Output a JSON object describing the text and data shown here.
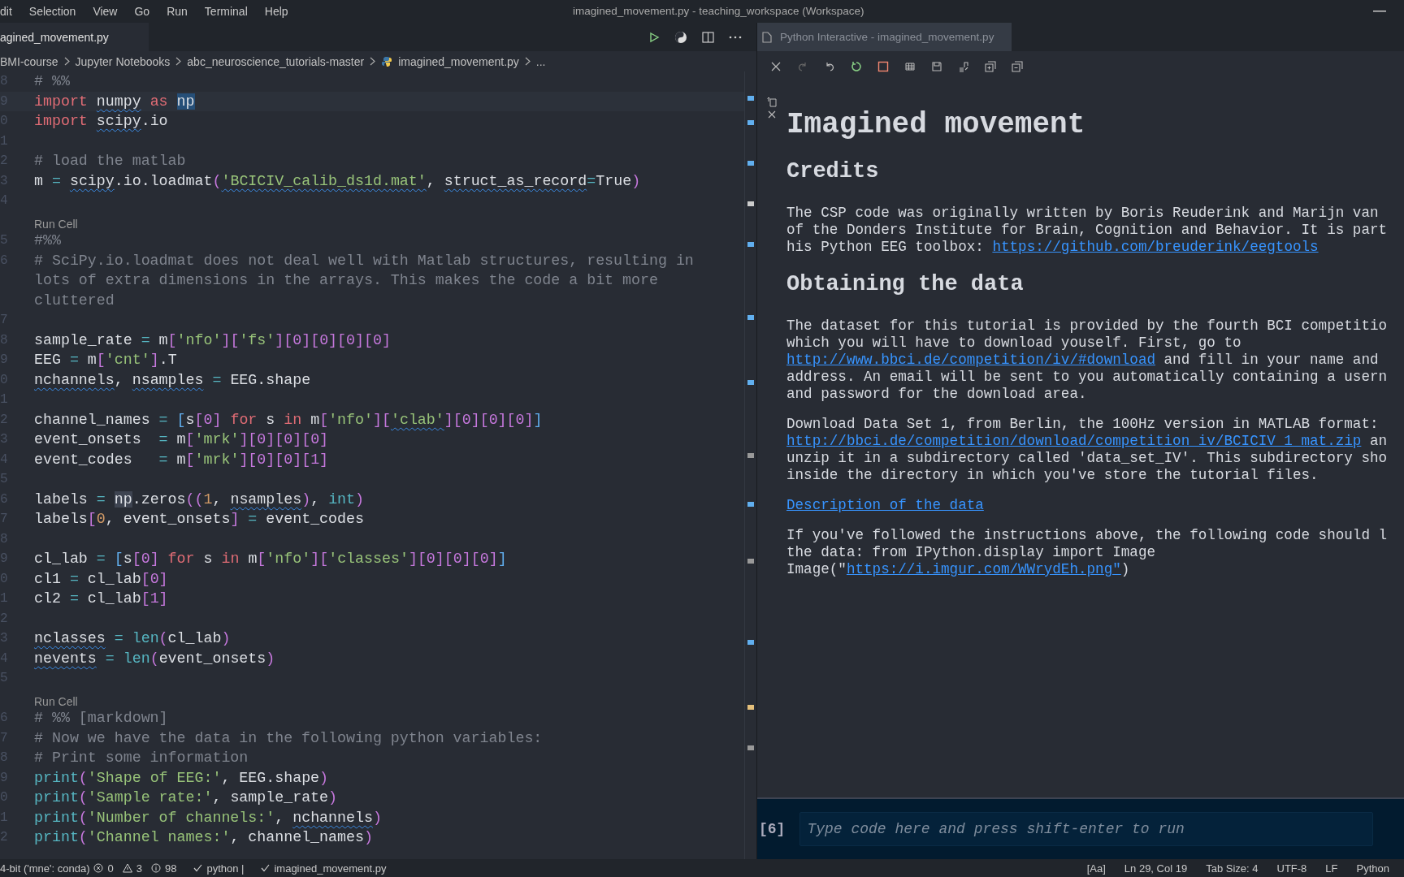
{
  "title_bar": {
    "menu": [
      "dit",
      "Selection",
      "View",
      "Go",
      "Run",
      "Terminal",
      "Help"
    ],
    "title": "imagined_movement.py - teaching_workspace (Workspace)"
  },
  "editor": {
    "tab": {
      "label": "agined_movement.py",
      "selected": true
    },
    "breadcrumbs": [
      "BMI-course",
      "Jupyter Notebooks",
      "abc_neuroscience_tutorials-master",
      "imagined_movement.py",
      "..."
    ],
    "lines": [
      {
        "number": "8",
        "tokens": [
          {
            "kind": "cm",
            "text": "# %%"
          }
        ]
      },
      {
        "number": "9",
        "current": true,
        "tokens": [
          {
            "kind": "kw",
            "text": "import "
          },
          {
            "kind": "id",
            "text": "numpy",
            "squiggle": true
          },
          {
            "kind": "kw",
            "text": " as "
          },
          {
            "kind": "id",
            "text": "np"
          }
        ]
      },
      {
        "number": "0",
        "tokens": [
          {
            "kind": "kw",
            "text": "import "
          },
          {
            "kind": "id",
            "text": "scipy",
            "squiggle": true
          },
          {
            "kind": "id",
            "text": ".io"
          }
        ]
      },
      {
        "number": "1"
      },
      {
        "number": "2",
        "tokens": [
          {
            "kind": "cm",
            "text": "# load the matlab"
          }
        ]
      },
      {
        "number": "3",
        "tokens": [
          {
            "kind": "id",
            "text": "m"
          },
          {
            "kind": "op",
            "text": " = "
          },
          {
            "kind": "id",
            "text": "scipy",
            "squiggle": true
          },
          {
            "kind": "id",
            "text": ".io.loadmat"
          },
          {
            "kind": "b1",
            "text": "("
          },
          {
            "kind": "str",
            "text": "'BCICIV_calib_ds1d.mat'",
            "squiggle": true
          },
          {
            "kind": "id",
            "text": ", "
          },
          {
            "kind": "id",
            "text": "struct_as_record",
            "squiggle": true
          },
          {
            "kind": "op",
            "text": "="
          },
          {
            "kind": "id",
            "text": "True"
          },
          {
            "kind": "b1",
            "text": ")"
          }
        ]
      },
      {
        "number": "4"
      },
      {
        "kind": "codelens",
        "text": "Run Cell"
      },
      {
        "number": "5",
        "tokens": [
          {
            "kind": "cm",
            "text": "#%%"
          }
        ]
      },
      {
        "number": "6",
        "tokens": [
          {
            "kind": "cm",
            "text": "# SciPy.io.loadmat does not deal well with Matlab structures, resulting in"
          }
        ]
      },
      {
        "tokens": [
          {
            "kind": "cm",
            "text": "lots of extra dimensions in the arrays. This makes the code a bit more"
          }
        ]
      },
      {
        "tokens": [
          {
            "kind": "cm",
            "text": "cluttered"
          }
        ]
      },
      {
        "number": "7"
      },
      {
        "number": "8",
        "tokens": [
          {
            "kind": "id",
            "text": "sample_rate"
          },
          {
            "kind": "op",
            "text": " = "
          },
          {
            "kind": "id",
            "text": "m"
          },
          {
            "kind": "b1",
            "text": "["
          },
          {
            "kind": "str",
            "text": "'nfo'"
          },
          {
            "kind": "b1",
            "text": "]["
          },
          {
            "kind": "str",
            "text": "'fs'"
          },
          {
            "kind": "b1",
            "text": "][0][0][0][0]"
          }
        ]
      },
      {
        "number": "9",
        "tokens": [
          {
            "kind": "id",
            "text": "EEG"
          },
          {
            "kind": "op",
            "text": " = "
          },
          {
            "kind": "id",
            "text": "m"
          },
          {
            "kind": "b1",
            "text": "["
          },
          {
            "kind": "str",
            "text": "'cnt'"
          },
          {
            "kind": "b1",
            "text": "]"
          },
          {
            "kind": "id",
            "text": ".T"
          }
        ]
      },
      {
        "number": "0",
        "tokens": [
          {
            "kind": "id",
            "text": "nchannels",
            "squiggle": true
          },
          {
            "kind": "id",
            "text": ", "
          },
          {
            "kind": "id",
            "text": "nsamples",
            "squiggle": true
          },
          {
            "kind": "op",
            "text": " = "
          },
          {
            "kind": "id",
            "text": "EEG.shape"
          }
        ]
      },
      {
        "number": "1"
      },
      {
        "number": "2",
        "tokens": [
          {
            "kind": "id",
            "text": "channel_names"
          },
          {
            "kind": "op",
            "text": " = "
          },
          {
            "kind": "b2",
            "text": "["
          },
          {
            "kind": "id",
            "text": "s"
          },
          {
            "kind": "b1",
            "text": "[0]"
          },
          {
            "kind": "kw",
            "text": " for "
          },
          {
            "kind": "id",
            "text": "s"
          },
          {
            "kind": "kw",
            "text": " in "
          },
          {
            "kind": "id",
            "text": "m"
          },
          {
            "kind": "b1",
            "text": "["
          },
          {
            "kind": "str",
            "text": "'nfo'"
          },
          {
            "kind": "b1",
            "text": "]["
          },
          {
            "kind": "str",
            "text": "'clab'",
            "squiggle": true
          },
          {
            "kind": "b1",
            "text": "][0][0][0]"
          },
          {
            "kind": "b2",
            "text": "]"
          }
        ]
      },
      {
        "number": "3",
        "tokens": [
          {
            "kind": "id",
            "text": "event_onsets"
          },
          {
            "kind": "op",
            "text": "  = "
          },
          {
            "kind": "id",
            "text": "m"
          },
          {
            "kind": "b1",
            "text": "["
          },
          {
            "kind": "str",
            "text": "'mrk'"
          },
          {
            "kind": "b1",
            "text": "][0][0][0]"
          }
        ]
      },
      {
        "number": "4",
        "tokens": [
          {
            "kind": "id",
            "text": "event_codes"
          },
          {
            "kind": "op",
            "text": "   = "
          },
          {
            "kind": "id",
            "text": "m"
          },
          {
            "kind": "b1",
            "text": "["
          },
          {
            "kind": "str",
            "text": "'mrk'"
          },
          {
            "kind": "b1",
            "text": "][0][0][1]"
          }
        ]
      },
      {
        "number": "5"
      },
      {
        "number": "6",
        "tokens": [
          {
            "kind": "id",
            "text": "labels"
          },
          {
            "kind": "op",
            "text": " = "
          },
          {
            "kind": "id",
            "text": "np",
            "highlight": true
          },
          {
            "kind": "id",
            "text": ".zeros"
          },
          {
            "kind": "b1",
            "text": "(("
          },
          {
            "kind": "num",
            "text": "1"
          },
          {
            "kind": "id",
            "text": ", "
          },
          {
            "kind": "id",
            "text": "nsamples",
            "squiggle": true
          },
          {
            "kind": "b1",
            "text": ")"
          },
          {
            "kind": "id",
            "text": ", "
          },
          {
            "kind": "fn",
            "text": "int"
          },
          {
            "kind": "b1",
            "text": ")"
          }
        ]
      },
      {
        "number": "7",
        "tokens": [
          {
            "kind": "id",
            "text": "labels"
          },
          {
            "kind": "b1",
            "text": "["
          },
          {
            "kind": "num",
            "text": "0"
          },
          {
            "kind": "id",
            "text": ", event_onsets"
          },
          {
            "kind": "b1",
            "text": "]"
          },
          {
            "kind": "op",
            "text": " = "
          },
          {
            "kind": "id",
            "text": "event_codes"
          }
        ]
      },
      {
        "number": "8"
      },
      {
        "number": "9",
        "tokens": [
          {
            "kind": "id",
            "text": "cl_lab"
          },
          {
            "kind": "op",
            "text": " = "
          },
          {
            "kind": "b2",
            "text": "["
          },
          {
            "kind": "id",
            "text": "s"
          },
          {
            "kind": "b1",
            "text": "[0]"
          },
          {
            "kind": "kw",
            "text": " for "
          },
          {
            "kind": "id",
            "text": "s"
          },
          {
            "kind": "kw",
            "text": " in "
          },
          {
            "kind": "id",
            "text": "m"
          },
          {
            "kind": "b1",
            "text": "["
          },
          {
            "kind": "str",
            "text": "'nfo'"
          },
          {
            "kind": "b1",
            "text": "]["
          },
          {
            "kind": "str",
            "text": "'classes'"
          },
          {
            "kind": "b1",
            "text": "][0][0][0]"
          },
          {
            "kind": "b2",
            "text": "]"
          }
        ]
      },
      {
        "number": "0",
        "tokens": [
          {
            "kind": "id",
            "text": "cl1"
          },
          {
            "kind": "op",
            "text": " = "
          },
          {
            "kind": "id",
            "text": "cl_lab"
          },
          {
            "kind": "b1",
            "text": "[0]"
          }
        ]
      },
      {
        "number": "1",
        "tokens": [
          {
            "kind": "id",
            "text": "cl2"
          },
          {
            "kind": "op",
            "text": " = "
          },
          {
            "kind": "id",
            "text": "cl_lab"
          },
          {
            "kind": "b1",
            "text": "[1]"
          }
        ]
      },
      {
        "number": "2"
      },
      {
        "number": "3",
        "tokens": [
          {
            "kind": "id",
            "text": "nclasses",
            "squiggle": true
          },
          {
            "kind": "op",
            "text": " = "
          },
          {
            "kind": "fn",
            "text": "len"
          },
          {
            "kind": "b1",
            "text": "("
          },
          {
            "kind": "id",
            "text": "cl_lab"
          },
          {
            "kind": "b1",
            "text": ")"
          }
        ]
      },
      {
        "number": "4",
        "tokens": [
          {
            "kind": "id",
            "text": "nevents",
            "squiggle": true
          },
          {
            "kind": "op",
            "text": " = "
          },
          {
            "kind": "fn",
            "text": "len"
          },
          {
            "kind": "b1",
            "text": "("
          },
          {
            "kind": "id",
            "text": "event_onsets"
          },
          {
            "kind": "b1",
            "text": ")"
          }
        ]
      },
      {
        "number": "5"
      },
      {
        "kind": "codelens",
        "text": "Run Cell"
      },
      {
        "number": "6",
        "tokens": [
          {
            "kind": "cm",
            "text": "# %% [markdown]"
          }
        ]
      },
      {
        "number": "7",
        "tokens": [
          {
            "kind": "cm",
            "text": "# Now we have the data in the following python variables:"
          }
        ]
      },
      {
        "number": "8",
        "tokens": [
          {
            "kind": "cm",
            "text": "# Print some information"
          }
        ]
      },
      {
        "number": "9",
        "tokens": [
          {
            "kind": "fn",
            "text": "print"
          },
          {
            "kind": "b1",
            "text": "("
          },
          {
            "kind": "str",
            "text": "'Shape of EEG:'"
          },
          {
            "kind": "id",
            "text": ", EEG.shape"
          },
          {
            "kind": "b1",
            "text": ")"
          }
        ]
      },
      {
        "number": "0",
        "tokens": [
          {
            "kind": "fn",
            "text": "print"
          },
          {
            "kind": "b1",
            "text": "("
          },
          {
            "kind": "str",
            "text": "'Sample rate:'"
          },
          {
            "kind": "id",
            "text": ", sample_rate"
          },
          {
            "kind": "b1",
            "text": ")"
          }
        ]
      },
      {
        "number": "1",
        "tokens": [
          {
            "kind": "fn",
            "text": "print"
          },
          {
            "kind": "b1",
            "text": "("
          },
          {
            "kind": "str",
            "text": "'Number of channels:'"
          },
          {
            "kind": "id",
            "text": ", "
          },
          {
            "kind": "id",
            "text": "nchannels",
            "squiggle": true
          },
          {
            "kind": "b1",
            "text": ")"
          }
        ]
      },
      {
        "number": "2",
        "tokens": [
          {
            "kind": "fn",
            "text": "print"
          },
          {
            "kind": "b1",
            "text": "("
          },
          {
            "kind": "str",
            "text": "'Channel names:'"
          },
          {
            "kind": "id",
            "text": ", channel_names"
          },
          {
            "kind": "b1",
            "text": ")"
          }
        ]
      }
    ]
  },
  "interactive": {
    "tab": {
      "label": "Python Interactive - imagined_movement.py",
      "selected": true
    },
    "blocks": [
      {
        "kind": "h1",
        "text": "Imagined movement"
      },
      {
        "kind": "h2",
        "text": "Credits"
      },
      {
        "kind": "p",
        "lines": [
          [
            {
              "text": "The CSP code was originally written by Boris Reuderink and Marijn van"
            }
          ],
          [
            {
              "text": "of the Donders Institute for Brain, Cognition and Behavior. It is part"
            }
          ],
          [
            {
              "text": "his Python EEG toolbox: "
            },
            {
              "text": "https://github.com/breuderink/eegtools",
              "link": true
            }
          ]
        ]
      },
      {
        "kind": "h2",
        "text": "Obtaining the data"
      },
      {
        "kind": "p",
        "lines": [
          [
            {
              "text": "The dataset for this tutorial is provided by the fourth BCI competitio"
            }
          ],
          [
            {
              "text": "which you will have to download youself. First, go to"
            }
          ],
          [
            {
              "text": "http://www.bbci.de/competition/iv/#download",
              "link": true
            },
            {
              "text": " and fill in your name and"
            }
          ],
          [
            {
              "text": "address. An email will be sent to you automatically containing a usern"
            }
          ],
          [
            {
              "text": "and password for the download area."
            }
          ]
        ]
      },
      {
        "kind": "p",
        "lines": [
          [
            {
              "text": "Download Data Set 1, from Berlin, the 100Hz version in MATLAB format:"
            }
          ],
          [
            {
              "text": "http://bbci.de/competition/download/competition_iv/BCICIV_1_mat.zip",
              "link": true
            },
            {
              "text": " an"
            }
          ],
          [
            {
              "text": "unzip it in a subdirectory called 'data_set_IV'. This subdirectory sho"
            }
          ],
          [
            {
              "text": "inside the directory in which you've store the tutorial files."
            }
          ]
        ]
      },
      {
        "kind": "p",
        "lines": [
          [
            {
              "text": "Description of the data",
              "link": true
            }
          ]
        ]
      },
      {
        "kind": "p",
        "lines": [
          [
            {
              "text": "If you've followed the instructions above, the following code should l"
            }
          ],
          [
            {
              "text": "the data: from IPython.display import Image"
            }
          ],
          [
            {
              "text": "Image(\""
            },
            {
              "text": "https://i.imgur.com/WWrydEh.png\"",
              "link": true
            },
            {
              "text": ")"
            }
          ]
        ]
      }
    ],
    "input": {
      "prompt": "[6]",
      "placeholder": "Type code here and press shift-enter to run"
    }
  },
  "status_bar": {
    "interpreter": "4-bit ('mne': conda)",
    "errors": "0",
    "warnings": "3",
    "infos": "98",
    "checks": [
      "python |",
      "imagined_movement.py"
    ],
    "right": [
      "[Aa]",
      "Ln 29, Col 19",
      "Tab Size: 4",
      "UTF-8",
      "LF",
      "Python"
    ]
  }
}
